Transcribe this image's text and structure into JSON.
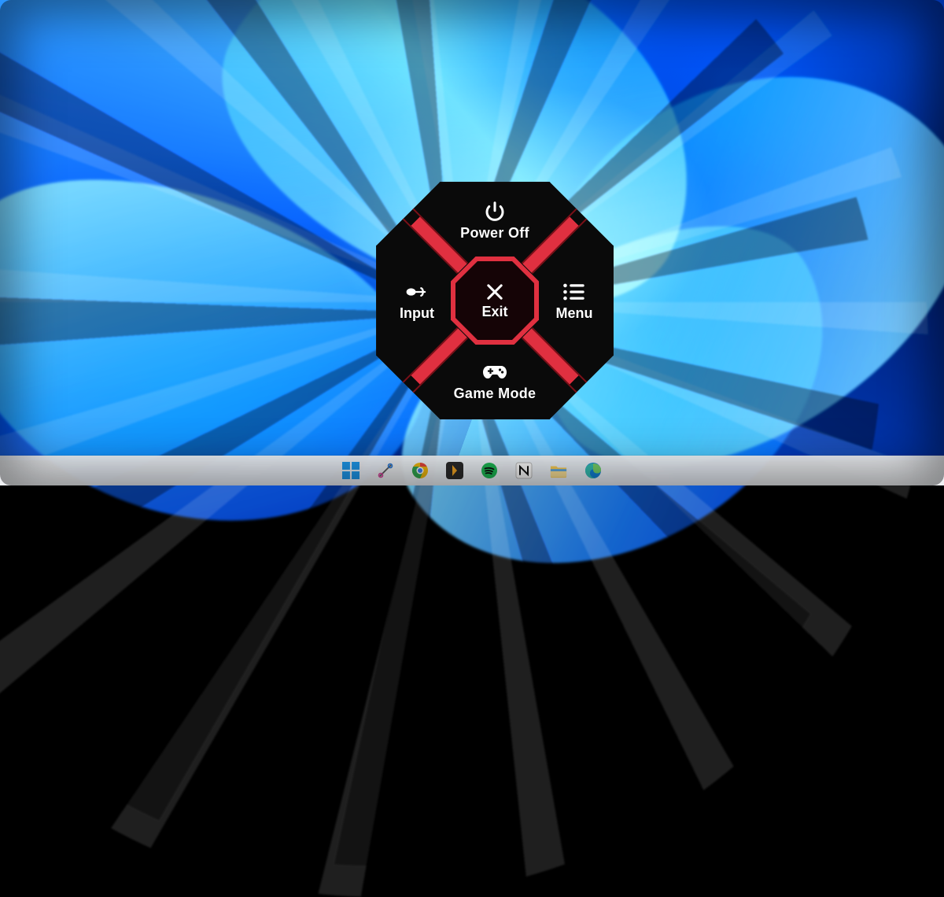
{
  "osd": {
    "top": {
      "label": "Power Off",
      "icon": "power-icon"
    },
    "bottom": {
      "label": "Game Mode",
      "icon": "gamepad-icon"
    },
    "left": {
      "label": "Input",
      "icon": "input-source-icon"
    },
    "right": {
      "label": "Menu",
      "icon": "menu-list-icon"
    },
    "center": {
      "label": "Exit",
      "icon": "close-icon"
    },
    "accent_color": "#e03040"
  },
  "taskbar": {
    "icons": [
      {
        "name": "start-icon"
      },
      {
        "name": "snipping-tool-icon"
      },
      {
        "name": "chrome-icon"
      },
      {
        "name": "plex-icon"
      },
      {
        "name": "spotify-icon"
      },
      {
        "name": "notion-icon"
      },
      {
        "name": "file-explorer-icon"
      },
      {
        "name": "edge-icon"
      }
    ]
  }
}
